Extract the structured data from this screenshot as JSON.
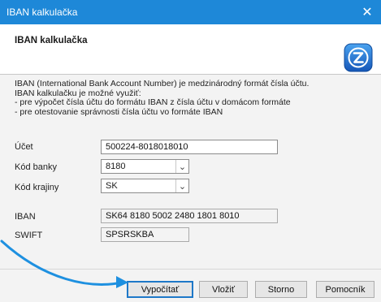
{
  "window": {
    "title": "IBAN kalkulačka",
    "close_symbol": "✕"
  },
  "header": {
    "title": "IBAN kalkulačka",
    "logo_icon": "z-logo-icon"
  },
  "description": {
    "lines": [
      "IBAN (International Bank Account Number) je medzinárodný formát čísla účtu.",
      "IBAN kalkulačku je možné využiť:",
      " - pre výpočet čísla účtu do formátu IBAN z čísla účtu v domácom formáte",
      " - pre otestovanie správnosti čísla účtu vo formáte IBAN"
    ]
  },
  "form": {
    "account_label": "Účet",
    "account_value": "500224-8018018010",
    "bank_code_label": "Kód banky",
    "bank_code_value": "8180",
    "country_code_label": "Kód krajiny",
    "country_code_value": "SK",
    "iban_label": "IBAN",
    "iban_value": "SK64 8180 5002 2480 1801 8010",
    "swift_label": "SWIFT",
    "swift_value": "SPSRSKBA",
    "dropdown_symbol": "⌄"
  },
  "buttons": {
    "calculate": "Vypočítať",
    "insert": "Vložiť",
    "cancel": "Storno",
    "help": "Pomocník"
  },
  "colors": {
    "titlebar": "#1e88d8",
    "accent_arrow": "#1e90e0",
    "logo_blue": "#1f6fd0"
  }
}
